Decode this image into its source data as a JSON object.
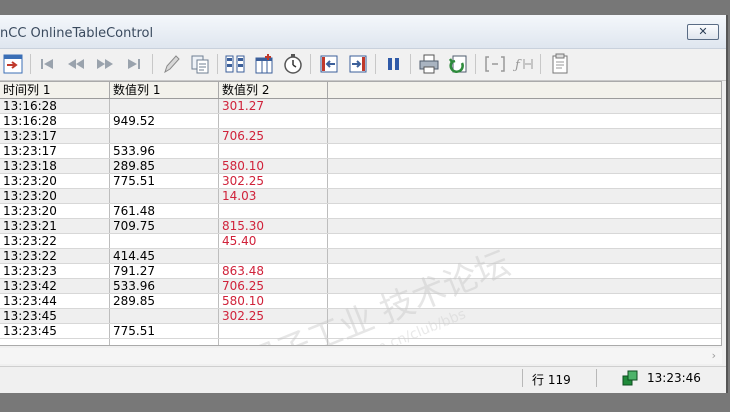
{
  "window": {
    "title": "nCC OnlineTableControl",
    "close_glyph": "✕"
  },
  "toolbar": {
    "icons": [
      "config-dialog-icon",
      "first-record-icon",
      "previous-record-icon",
      "next-record-icon",
      "last-record-icon",
      "edit-icon",
      "copy-rows-icon",
      "select-data-connection-icon",
      "select-columns-icon",
      "time-range-icon",
      "first-line-icon",
      "last-line-icon",
      "stop-icon",
      "print-icon",
      "export-icon",
      "define-statistics-area-icon",
      "calculate-statistics-icon",
      "more-icon"
    ]
  },
  "table": {
    "headers": [
      "时间列 1",
      "数值列 1",
      "数值列 2"
    ],
    "rows": [
      {
        "time": "13:16:28",
        "v1": "",
        "v2": "301.27"
      },
      {
        "time": "13:16:28",
        "v1": "949.52",
        "v2": ""
      },
      {
        "time": "13:23:17",
        "v1": "",
        "v2": "706.25"
      },
      {
        "time": "13:23:17",
        "v1": "533.96",
        "v2": ""
      },
      {
        "time": "13:23:18",
        "v1": "289.85",
        "v2": "580.10"
      },
      {
        "time": "13:23:20",
        "v1": "775.51",
        "v2": "302.25"
      },
      {
        "time": "13:23:20",
        "v1": "",
        "v2": "14.03"
      },
      {
        "time": "13:23:20",
        "v1": "761.48",
        "v2": ""
      },
      {
        "time": "13:23:21",
        "v1": "709.75",
        "v2": "815.30"
      },
      {
        "time": "13:23:22",
        "v1": "",
        "v2": "45.40"
      },
      {
        "time": "13:23:22",
        "v1": "414.45",
        "v2": ""
      },
      {
        "time": "13:23:23",
        "v1": "791.27",
        "v2": "863.48"
      },
      {
        "time": "13:23:42",
        "v1": "533.96",
        "v2": "706.25"
      },
      {
        "time": "13:23:44",
        "v1": "289.85",
        "v2": "580.10"
      },
      {
        "time": "13:23:45",
        "v1": "",
        "v2": "302.25"
      },
      {
        "time": "13:23:45",
        "v1": "775.51",
        "v2": ""
      }
    ]
  },
  "statusbar": {
    "row_count": "行 119",
    "time": "13:23:46",
    "connection_icon": "connection-status-icon"
  },
  "scroll": {
    "right_arrow": "›"
  },
  "watermark": {
    "line1": "西门子工业",
    "line2": "技术论坛",
    "url": "www.ad.siemens.com.cn/club/bbs"
  },
  "colors": {
    "value2_text": "#d0223a",
    "alt_row": "#efefef",
    "header_bg": "#f3f2ec"
  }
}
